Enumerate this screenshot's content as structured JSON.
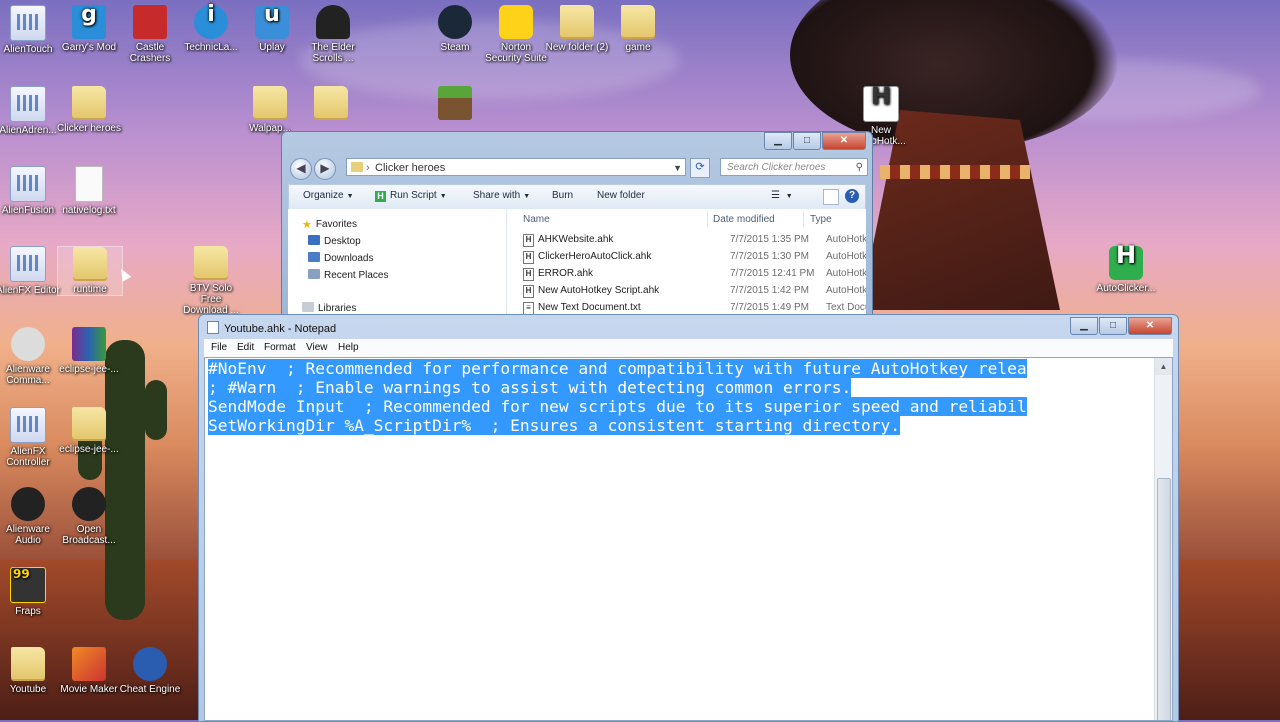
{
  "desktop": {
    "icons": [
      {
        "label": "AlienTouch",
        "icon": "alientouch-icon"
      },
      {
        "label": "Garry's Mod",
        "icon": "garrys-mod-icon"
      },
      {
        "label": "Castle Crashers",
        "icon": "castle-crashers-icon"
      },
      {
        "label": "TechnicLa...",
        "icon": "technic-launcher-icon"
      },
      {
        "label": "Uplay",
        "icon": "uplay-icon"
      },
      {
        "label": "The Elder Scrolls ...",
        "icon": "elder-scrolls-icon"
      },
      {
        "label": "Steam",
        "icon": "steam-icon"
      },
      {
        "label": "Norton Security Suite",
        "icon": "norton-icon"
      },
      {
        "label": "New folder (2)",
        "icon": "folder-icon"
      },
      {
        "label": "game",
        "icon": "folder-icon"
      },
      {
        "label": "AlienAdren...",
        "icon": "alienadrenaline-icon"
      },
      {
        "label": "Clicker heroes",
        "icon": "folder-icon"
      },
      {
        "label": "Walpap...",
        "icon": "folder-icon"
      },
      {
        "label": "AlienFusion",
        "icon": "alienfusion-icon"
      },
      {
        "label": "nativelog.txt",
        "icon": "text-file-icon"
      },
      {
        "label": "AlienFX Editor",
        "icon": "alienfx-editor-icon"
      },
      {
        "label": "runtime",
        "icon": "folder-icon"
      },
      {
        "label": "BTV Solo Free Download ...",
        "icon": "folder-icon"
      },
      {
        "label": "Alienware Comma...",
        "icon": "alienware-command-icon"
      },
      {
        "label": "eclipse-jee-...",
        "icon": "winrar-icon"
      },
      {
        "label": "AlienFX Controller",
        "icon": "alienfx-controller-icon"
      },
      {
        "label": "eclipse-jee-...",
        "icon": "folder-icon"
      },
      {
        "label": "Alienware Audio",
        "icon": "alienware-audio-icon"
      },
      {
        "label": "Open Broadcast...",
        "icon": "obs-icon"
      },
      {
        "label": "Fraps",
        "icon": "fraps-icon"
      },
      {
        "label": "Youtube",
        "icon": "folder-icon"
      },
      {
        "label": "Movie Maker",
        "icon": "movie-maker-icon"
      },
      {
        "label": "Cheat Engine",
        "icon": "cheat-engine-icon"
      },
      {
        "label": "New AutoHotk...",
        "icon": "autohotkey-file-icon"
      },
      {
        "label": "AutoClicker...",
        "icon": "autohotkey-icon"
      }
    ]
  },
  "explorer": {
    "path": "Clicker heroes",
    "search_placeholder": "Search Clicker heroes",
    "toolbar": {
      "organize": "Organize",
      "run_script": "Run Script",
      "share_with": "Share with",
      "burn": "Burn",
      "new_folder": "New folder"
    },
    "nav": {
      "favorites": "Favorites",
      "desktop": "Desktop",
      "downloads": "Downloads",
      "recent_places": "Recent Places",
      "libraries": "Libraries"
    },
    "columns": {
      "name": "Name",
      "date_modified": "Date modified",
      "type": "Type"
    },
    "files": [
      {
        "name": "AHKWebsite.ahk",
        "date": "7/7/2015 1:35 PM",
        "type": "AutoHotk"
      },
      {
        "name": "ClickerHeroAutoClick.ahk",
        "date": "7/7/2015 1:30 PM",
        "type": "AutoHotk"
      },
      {
        "name": "ERROR.ahk",
        "date": "7/7/2015 12:41 PM",
        "type": "AutoHotk"
      },
      {
        "name": "New AutoHotkey Script.ahk",
        "date": "7/7/2015 1:42 PM",
        "type": "AutoHotk"
      },
      {
        "name": "New Text Document.txt",
        "date": "7/7/2015 1:49 PM",
        "type": "Text Docu"
      }
    ]
  },
  "notepad": {
    "title": "Youtube.ahk - Notepad",
    "menu": {
      "file": "File",
      "edit": "Edit",
      "format": "Format",
      "view": "View",
      "help": "Help"
    },
    "lines": [
      "#NoEnv  ; Recommended for performance and compatibility with future AutoHotkey relea",
      "; #Warn  ; Enable warnings to assist with detecting common errors.",
      "SendMode Input  ; Recommended for new scripts due to its superior speed and reliabil",
      "SetWorkingDir %A_ScriptDir%  ; Ensures a consistent starting directory."
    ],
    "selection_color": "#3399ff"
  },
  "window_controls": {
    "minimize": "▁",
    "maximize": "□",
    "close": "✕"
  }
}
